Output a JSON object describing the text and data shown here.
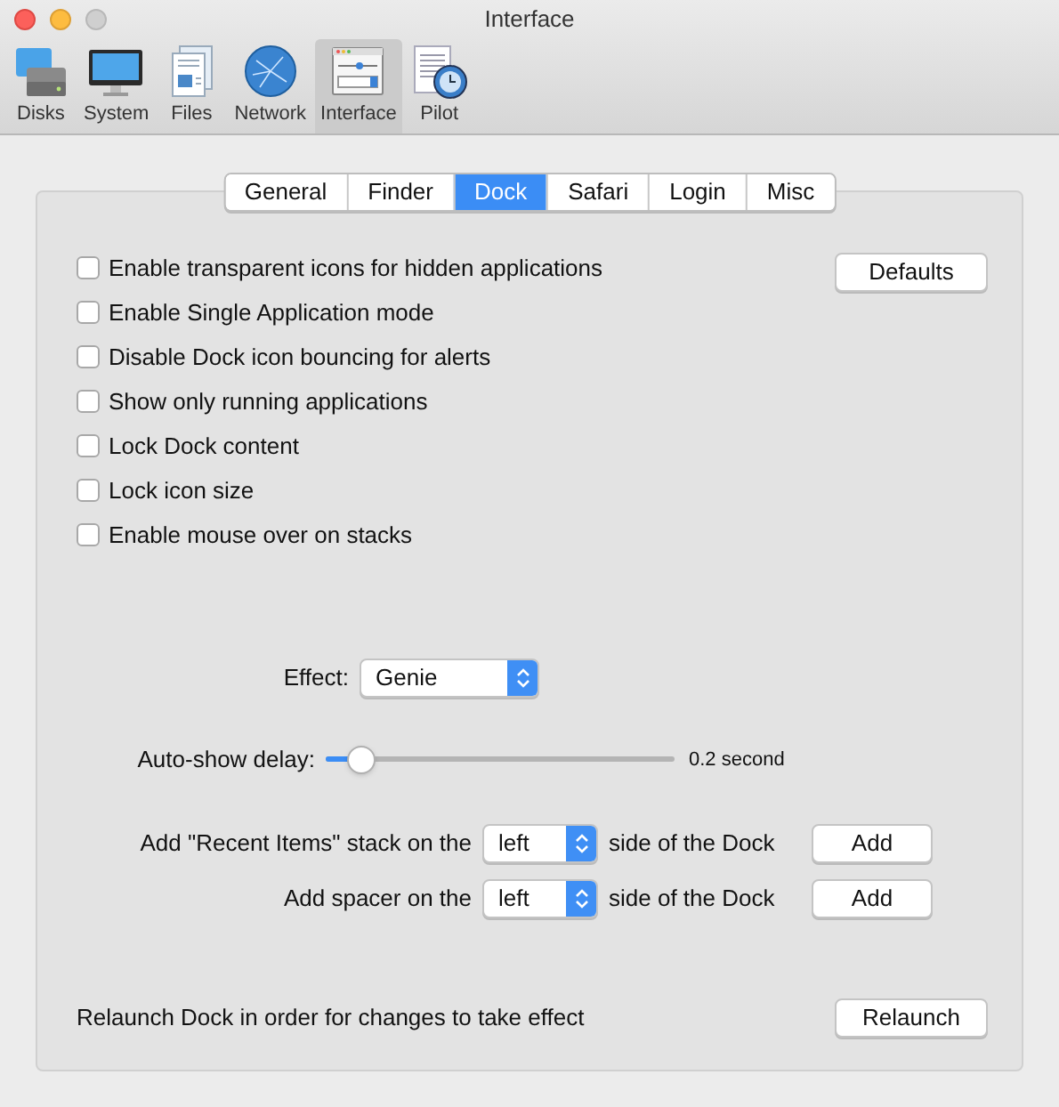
{
  "window": {
    "title": "Interface"
  },
  "toolbar": [
    {
      "label": "Disks",
      "kind": "disk",
      "selected": false
    },
    {
      "label": "System",
      "kind": "monitor",
      "selected": false
    },
    {
      "label": "Files",
      "kind": "document",
      "selected": false
    },
    {
      "label": "Network",
      "kind": "globe",
      "selected": false
    },
    {
      "label": "Interface",
      "kind": "window",
      "selected": true
    },
    {
      "label": "Pilot",
      "kind": "clock",
      "selected": false
    }
  ],
  "tabs": [
    {
      "label": "General",
      "selected": false
    },
    {
      "label": "Finder",
      "selected": false
    },
    {
      "label": "Dock",
      "selected": true
    },
    {
      "label": "Safari",
      "selected": false
    },
    {
      "label": "Login",
      "selected": false
    },
    {
      "label": "Misc",
      "selected": false
    }
  ],
  "options": [
    {
      "label": "Enable transparent icons for hidden applications",
      "checked": false
    },
    {
      "label": "Enable Single Application mode",
      "checked": false
    },
    {
      "label": "Disable Dock icon bouncing for alerts",
      "checked": false
    },
    {
      "label": "Show only running applications",
      "checked": false
    },
    {
      "label": "Lock Dock content",
      "checked": false
    },
    {
      "label": "Lock icon size",
      "checked": false
    },
    {
      "label": "Enable mouse over on stacks",
      "checked": false
    }
  ],
  "defaults_button": "Defaults",
  "effect": {
    "label": "Effect:",
    "value": "Genie"
  },
  "auto_show": {
    "label": "Auto-show delay:",
    "level": 0.1,
    "reading": "0.2 second"
  },
  "add_rows": [
    {
      "label": "Add \"Recent Items\" stack on the",
      "value": "left",
      "suffix": "side of the Dock",
      "button": "Add"
    },
    {
      "label": "Add spacer on the",
      "value": "left",
      "suffix": "side of the Dock",
      "button": "Add"
    }
  ],
  "relaunch": {
    "text": "Relaunch Dock in order for changes to take effect",
    "button": "Relaunch"
  }
}
